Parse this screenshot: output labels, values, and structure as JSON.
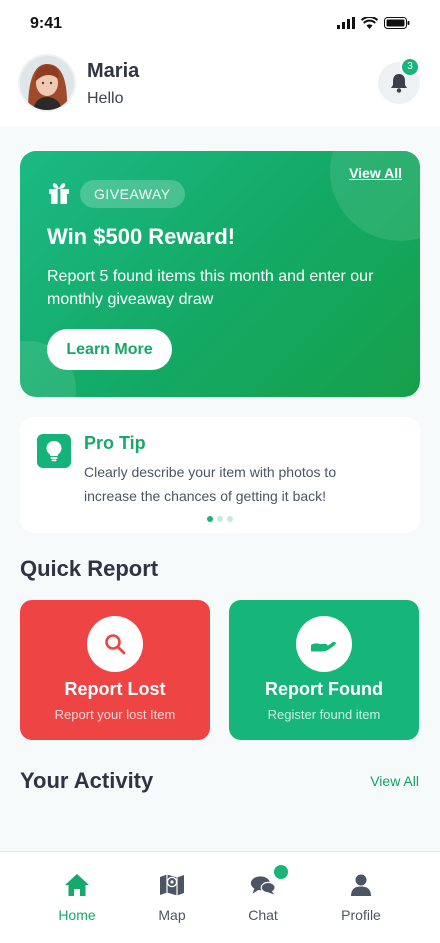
{
  "status_bar": {
    "time": "9:41"
  },
  "header": {
    "name": "Maria",
    "greeting": "Hello",
    "notification_count": "3"
  },
  "giveaway": {
    "tag": "GIVEAWAY",
    "view_all": "View All",
    "title": "Win $500 Reward!",
    "description": "Report 5 found items this month and enter our monthly giveaway draw",
    "cta": "Learn More"
  },
  "tip": {
    "title": "Pro Tip",
    "text": "Clearly describe your item with photos to increase the chances of getting it back!"
  },
  "quick_report": {
    "title": "Quick Report",
    "lost": {
      "title": "Report Lost",
      "subtitle": "Report your lost Item"
    },
    "found": {
      "title": "Report Found",
      "subtitle": "Register found item"
    }
  },
  "activity": {
    "title": "Your Activity",
    "view_all": "View All"
  },
  "nav": [
    {
      "label": "Home",
      "icon": "home-icon",
      "active": true
    },
    {
      "label": "Map",
      "icon": "map-icon",
      "active": false
    },
    {
      "label": "Chat",
      "icon": "chat-icon",
      "active": false
    },
    {
      "label": "Profile",
      "icon": "profile-icon",
      "active": false
    }
  ],
  "colors": {
    "primary": "#16b57a",
    "danger": "#ee4444",
    "text_dark": "#2f3342"
  }
}
